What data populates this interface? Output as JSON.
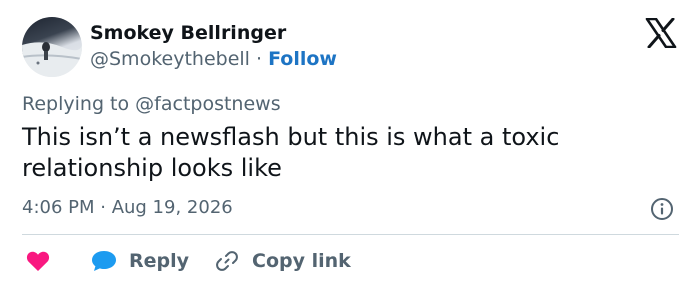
{
  "author": {
    "name": "Smokey Bellringer",
    "handle": "@Smokeythebell",
    "separator": "·",
    "follow_label": "Follow"
  },
  "reply_context": {
    "prefix": "Replying to",
    "mention": "@factpostnews"
  },
  "tweet": {
    "text": "This isn’t a newsflash but this is what a toxic relationship looks like",
    "timestamp": "4:06 PM · Aug 19, 2026"
  },
  "actions": {
    "reply_label": "Reply",
    "copy_link_label": "Copy link"
  },
  "colors": {
    "follow_blue": "#1d74c4",
    "heart_red": "#f91880",
    "reply_bubble_blue": "#1d9bf0",
    "secondary_text": "#536471"
  },
  "icons": {
    "logo": "x-logo-icon",
    "like": "heart-icon",
    "reply": "speech-bubble-icon",
    "copy": "link-icon",
    "info": "info-icon"
  }
}
